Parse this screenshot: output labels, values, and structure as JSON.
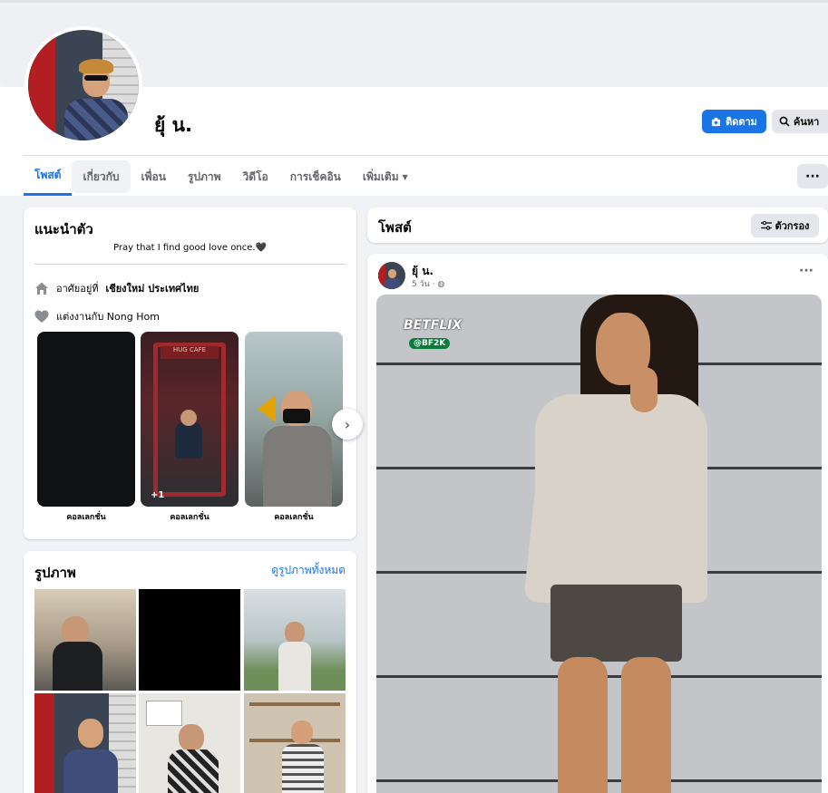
{
  "profile": {
    "name": "ยุ้ น."
  },
  "actions": {
    "follow_label": "ติดตาม",
    "search_label": "ค้นหา",
    "more_label": "···"
  },
  "tabs": [
    {
      "label": "โพสต์"
    },
    {
      "label": "เกี่ยวกับ"
    },
    {
      "label": "เพื่อน"
    },
    {
      "label": "รูปภาพ"
    },
    {
      "label": "วิดีโอ"
    },
    {
      "label": "การเช็คอิน"
    },
    {
      "label": "เพิ่มเติม"
    }
  ],
  "intro": {
    "title": "แนะนำตัว",
    "bio": "Pray that I find good love once.🖤",
    "lives_prefix": "อาศัยอยู่ที่",
    "lives_place": "เชียงใหม่ ประเทศไทย",
    "relationship": "แต่งงานกับ Nong Hom",
    "featured": [
      {
        "label": "คอลเลกชั่น"
      },
      {
        "label": "คอลเลกชั่น",
        "badge": "+1"
      },
      {
        "label": "คอลเลกชั่น"
      }
    ]
  },
  "photos": {
    "title": "รูปภาพ",
    "see_all": "ดูรูปภาพทั้งหมด"
  },
  "posts": {
    "title": "โพสต์",
    "filter_label": "ตัวกรอง",
    "items": [
      {
        "author": "ยุ้ น.",
        "time": "5 วัน ·",
        "watermark": "BETFLIX",
        "watermark_tag": "@BF2K"
      }
    ]
  },
  "colors": {
    "accent": "#1b74e4",
    "background": "#f0f2f5"
  }
}
